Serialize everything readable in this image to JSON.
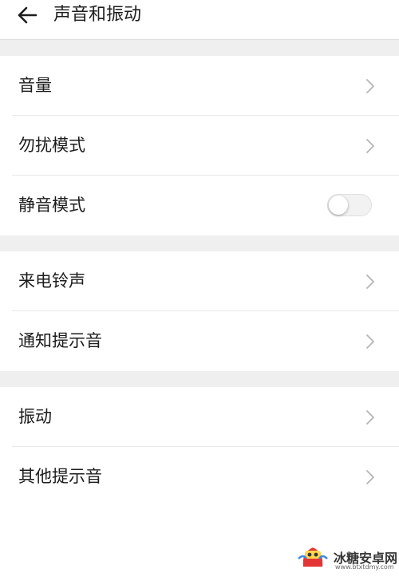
{
  "header": {
    "title": "声音和振动",
    "back_icon": "arrow-left-icon"
  },
  "groups": [
    {
      "items": [
        {
          "label": "音量",
          "control": "chevron"
        },
        {
          "label": "勿扰模式",
          "control": "chevron"
        },
        {
          "label": "静音模式",
          "control": "toggle",
          "toggle_on": false
        }
      ]
    },
    {
      "items": [
        {
          "label": "来电铃声",
          "control": "chevron"
        },
        {
          "label": "通知提示音",
          "control": "chevron"
        }
      ]
    },
    {
      "items": [
        {
          "label": "振动",
          "control": "chevron"
        },
        {
          "label": "其他提示音",
          "control": "chevron"
        }
      ]
    }
  ],
  "watermark": {
    "text": "冰糖安卓网",
    "url": "www.btxtdmy.com"
  },
  "colors": {
    "background": "#ffffff",
    "section_gap": "#efefef",
    "text": "#1c1c1c",
    "chevron": "#b5b5b5",
    "toggle_off": "#f2f2f2",
    "watermark_accent": "#e02020"
  }
}
